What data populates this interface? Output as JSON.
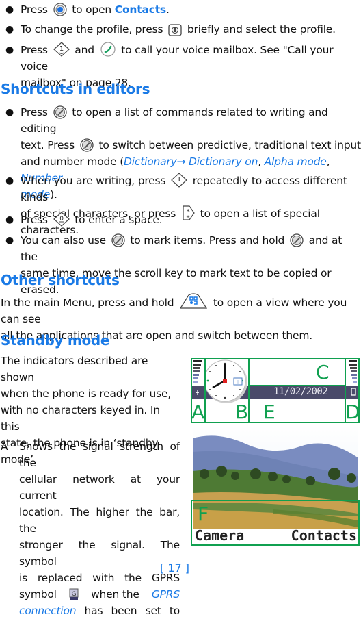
{
  "bullets_top": [
    {
      "parts": [
        "Press",
        "to open",
        "Contacts",
        "."
      ],
      "icon": "navi-key-icon"
    },
    {
      "parts": [
        "To change the profile, press",
        "briefly and select the profile."
      ],
      "icon": "power-key-icon"
    },
    {
      "parts": [
        "Press",
        "and",
        "to call your voice mailbox. See \"Call your voice",
        "mailbox\" on page 28."
      ],
      "icons": [
        "key-1-icon",
        "call-key-icon"
      ]
    }
  ],
  "section_editors": {
    "heading": "Shortcuts in editors",
    "b1": {
      "line1a": "Press",
      "line1b": "to open a list of commands related to writing and editing",
      "line2a": "text. Press",
      "line2b": "to switch between predictive, traditional text input",
      "line3a": "and number mode (",
      "link1": "Dictionary→ Dictionary on",
      "sep1": ", ",
      "link2": "Alpha mode",
      "sep2": ", ",
      "link3": "Number",
      "line4a": "mode",
      "line4b": ")."
    },
    "b2": {
      "line1a": "When you are writing, press",
      "line1b": "repeatedly to access different kinds",
      "line2a": "of special characters, or press",
      "line2b": "to open a list of special characters."
    },
    "b3": {
      "a": "Press",
      "b": "to enter a space."
    },
    "b4": {
      "line1a": "You can also use",
      "line1b": "to mark items. Press and hold",
      "line1c": "and at the",
      "line2": "same time, move the scroll key to mark text to be copied or erased."
    }
  },
  "section_other": {
    "heading": "Other shortcuts",
    "line1a": "In the main Menu, press and hold",
    "line1b": "to open a view where you can see",
    "line2": "all the applications that are open and switch between them."
  },
  "section_standby": {
    "heading": "Standby mode",
    "intro": [
      "The indicators described are shown",
      "when the phone is ready for use,",
      "with no characters keyed in. In this",
      "state, the phone is in ‘standby",
      "mode’."
    ],
    "itemA": {
      "letter": "A",
      "lines": [
        "Shows the signal strength of the",
        "cellular network at your current",
        "location. The higher the bar, the",
        "stronger the signal. The symbol",
        "is replaced with the GPRS"
      ],
      "line6a": "symbol",
      "line6b": "when the",
      "line6link": "GPRS",
      "line7link": "connection",
      "line7b": "has been set to"
    }
  },
  "phone_screen": {
    "date": "11/02/2002",
    "labels": {
      "A": "A",
      "B": "B",
      "C": "C",
      "D": "D",
      "E": "E",
      "F": "F"
    },
    "softkey_left": "Camera",
    "softkey_right": "Contacts",
    "signal_level_bars": 7,
    "battery_level_bars": 7
  },
  "page_number": "[ 17 ]",
  "colors": {
    "accent": "#1a7ae6",
    "frame_green": "#10a050",
    "status_bar": "#4a4a6a"
  }
}
